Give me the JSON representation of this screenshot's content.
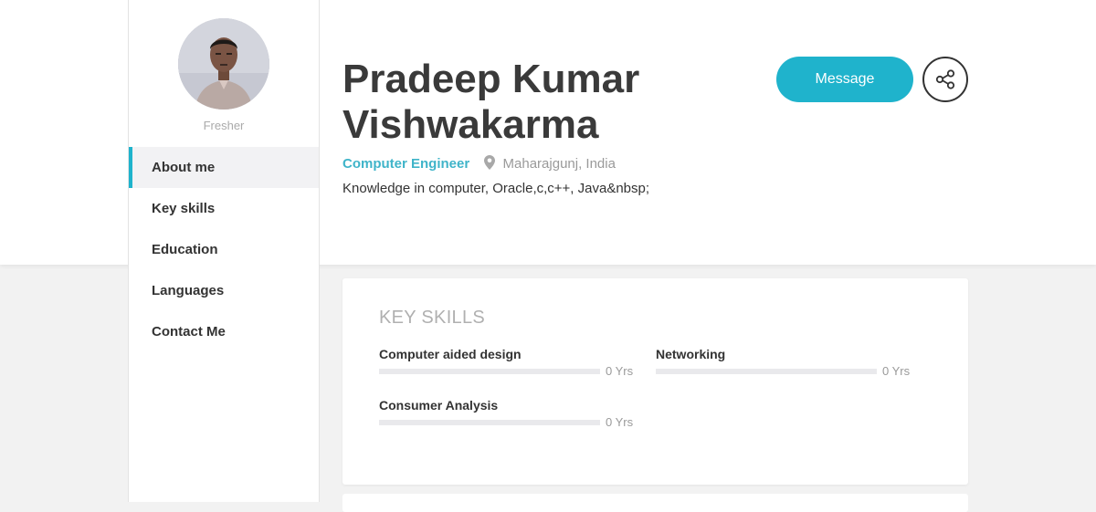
{
  "profile": {
    "name": "Pradeep Kumar Vishwakarma",
    "status": "Fresher",
    "role": "Computer Engineer",
    "location": "Maharajgunj, India",
    "bio": "Knowledge in computer, Oracle,c,c++, Java&nbsp;",
    "avatar_icon": "profile-photo"
  },
  "actions": {
    "message_label": "Message",
    "share_icon": "share-icon"
  },
  "sidebar": {
    "items": [
      {
        "label": "About me",
        "active": true
      },
      {
        "label": "Key skills",
        "active": false
      },
      {
        "label": "Education",
        "active": false
      },
      {
        "label": "Languages",
        "active": false
      },
      {
        "label": "Contact Me",
        "active": false
      }
    ]
  },
  "key_skills": {
    "title": "KEY SKILLS",
    "items": [
      {
        "name": "Computer aided design",
        "years": "0 Yrs",
        "level": 0
      },
      {
        "name": "Networking",
        "years": "0 Yrs",
        "level": 0
      },
      {
        "name": "Consumer Analysis",
        "years": "0 Yrs",
        "level": 0
      }
    ]
  },
  "colors": {
    "accent": "#1fb3cc",
    "role_text": "#3fb4c9",
    "muted": "#9a9a9a",
    "background": "#f2f2f2"
  }
}
